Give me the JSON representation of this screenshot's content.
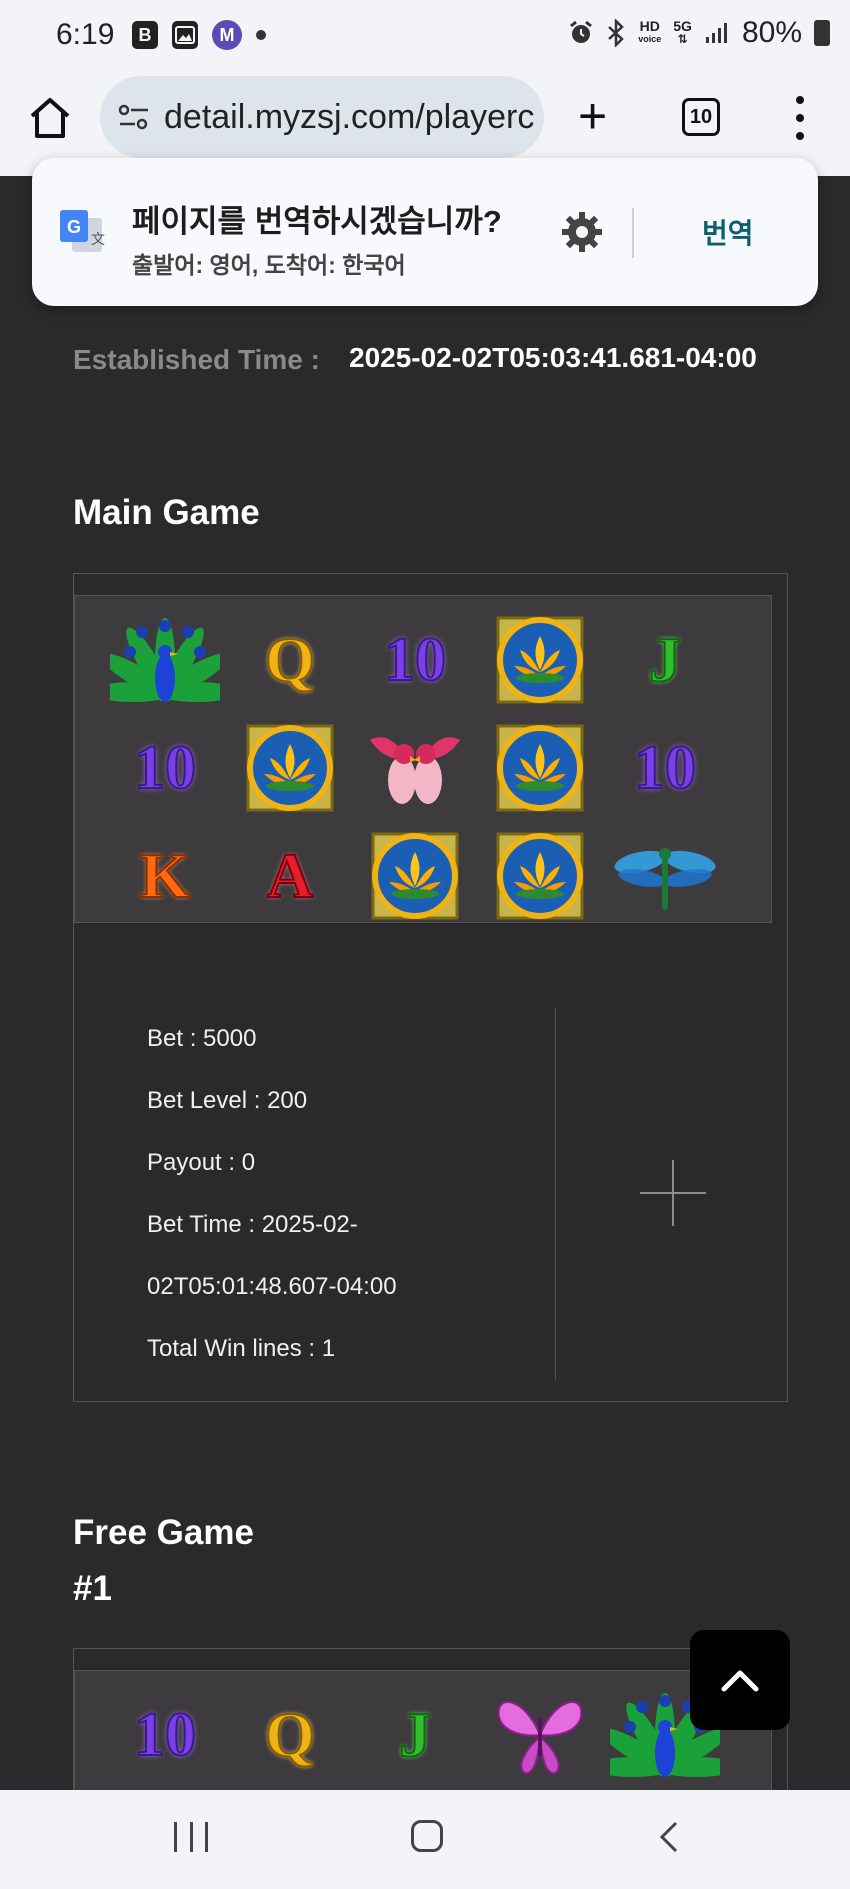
{
  "status_bar": {
    "time": "6:19",
    "icons_left": [
      "b-app-icon",
      "gallery-icon",
      "m-app-icon",
      "notification-dot"
    ],
    "icons_right": [
      "alarm-icon",
      "bluetooth-icon",
      "hd-voice-icon",
      "5g-icon",
      "signal-icon"
    ],
    "hd_label": "HD",
    "voice_label": "voice",
    "net_label": "5G",
    "battery": "80%"
  },
  "browser": {
    "url": "detail.myzsj.com/playerc",
    "tab_count": "10"
  },
  "translate_popup": {
    "title": "페이지를 번역하시겠습니까?",
    "subtitle": "출발어: 영어, 도착어: 한국어",
    "action": "번역",
    "colors": {
      "action": "#0b5f6e"
    }
  },
  "established": {
    "label": "Established Time :",
    "value": "2025-02-02T05:03:41.681-04:00"
  },
  "main_game": {
    "title": "Main Game",
    "reels": [
      [
        "peacock",
        "Q",
        "10",
        "lotus",
        "J"
      ],
      [
        "10",
        "lotus",
        "lovebirds",
        "lotus",
        "10"
      ],
      [
        "K",
        "A",
        "lotus",
        "lotus",
        "dragonfly"
      ]
    ],
    "info": {
      "bet": "Bet : 5000",
      "bet_level": "Bet Level : 200",
      "payout": "Payout : 0",
      "bet_time_1": "Bet Time : 2025-02-",
      "bet_time_2": "02T05:01:48.607-04:00",
      "total_win_lines": "Total Win lines : 1"
    }
  },
  "free_game": {
    "title_line1": "Free Game",
    "title_line2": "#1",
    "reels": [
      [
        "10",
        "Q",
        "J",
        "butterfly",
        "peacock"
      ]
    ]
  }
}
